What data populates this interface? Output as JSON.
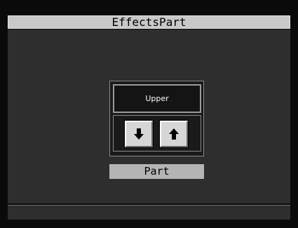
{
  "header": {
    "title": "EffectsPart"
  },
  "part_selector": {
    "value": "Upper",
    "down_icon": "arrow-down-icon",
    "up_icon": "arrow-up-icon",
    "label": "Part"
  },
  "colors": {
    "screen_background": "#2e2e2e",
    "title_bar": "#c8c8c8",
    "label_bar": "#b4b4b4",
    "button_face": "#d6d6d6"
  }
}
